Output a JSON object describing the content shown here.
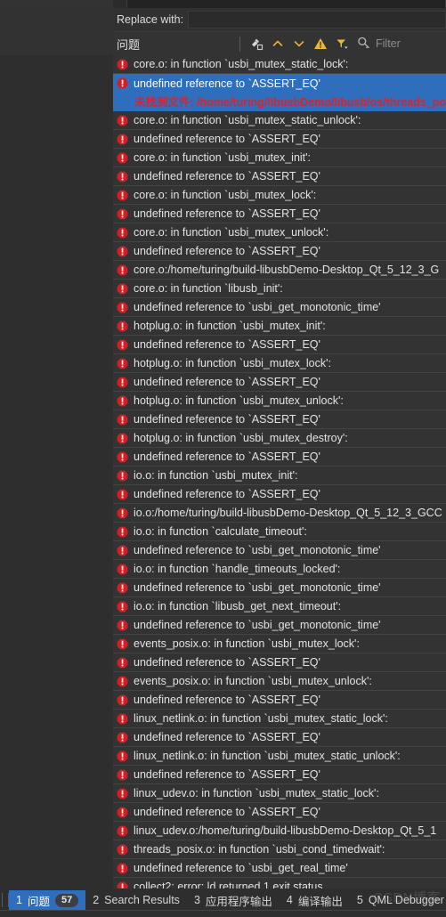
{
  "find_bar": {
    "replace_label": "Replace with:",
    "replace_value": "",
    "replace_placeholder": ""
  },
  "pane": {
    "title": "问题",
    "filter_placeholder": "Filter",
    "toolbar_icons": [
      "clear-issues-icon",
      "previous-issue-icon",
      "next-issue-icon",
      "warning-filter-icon",
      "filter-funnel-icon",
      "search-icon"
    ]
  },
  "colors": {
    "selection_blue": "#2f6ebd",
    "error_red": "#cc2127",
    "pane_bg": "#333333",
    "row_divider": "#434343",
    "warning_yellow": "#e8b931"
  },
  "issues": [
    {
      "text": "core.o: in function `usbi_mutex_static_lock':",
      "selected": false
    },
    {
      "text": "undefined reference to `ASSERT_EQ'",
      "selected": true,
      "detail": "未找到文件: /home/turing/libusbDemo/libusb/os/threads_posix"
    },
    {
      "text": "core.o: in function `usbi_mutex_static_unlock':",
      "selected": false
    },
    {
      "text": "undefined reference to `ASSERT_EQ'",
      "selected": false
    },
    {
      "text": "core.o: in function `usbi_mutex_init':",
      "selected": false
    },
    {
      "text": "undefined reference to `ASSERT_EQ'",
      "selected": false
    },
    {
      "text": "core.o: in function `usbi_mutex_lock':",
      "selected": false
    },
    {
      "text": "undefined reference to `ASSERT_EQ'",
      "selected": false
    },
    {
      "text": "core.o: in function `usbi_mutex_unlock':",
      "selected": false
    },
    {
      "text": "undefined reference to `ASSERT_EQ'",
      "selected": false
    },
    {
      "text": "core.o:/home/turing/build-libusbDemo-Desktop_Qt_5_12_3_G",
      "selected": false
    },
    {
      "text": "core.o: in function `libusb_init':",
      "selected": false
    },
    {
      "text": "undefined reference to `usbi_get_monotonic_time'",
      "selected": false
    },
    {
      "text": "hotplug.o: in function `usbi_mutex_init':",
      "selected": false
    },
    {
      "text": "undefined reference to `ASSERT_EQ'",
      "selected": false
    },
    {
      "text": "hotplug.o: in function `usbi_mutex_lock':",
      "selected": false
    },
    {
      "text": "undefined reference to `ASSERT_EQ'",
      "selected": false
    },
    {
      "text": "hotplug.o: in function `usbi_mutex_unlock':",
      "selected": false
    },
    {
      "text": "undefined reference to `ASSERT_EQ'",
      "selected": false
    },
    {
      "text": "hotplug.o: in function `usbi_mutex_destroy':",
      "selected": false
    },
    {
      "text": "undefined reference to `ASSERT_EQ'",
      "selected": false
    },
    {
      "text": "io.o: in function `usbi_mutex_init':",
      "selected": false
    },
    {
      "text": "undefined reference to `ASSERT_EQ'",
      "selected": false
    },
    {
      "text": "io.o:/home/turing/build-libusbDemo-Desktop_Qt_5_12_3_GCC",
      "selected": false
    },
    {
      "text": "io.o: in function `calculate_timeout':",
      "selected": false
    },
    {
      "text": "undefined reference to `usbi_get_monotonic_time'",
      "selected": false
    },
    {
      "text": "io.o: in function `handle_timeouts_locked':",
      "selected": false
    },
    {
      "text": "undefined reference to `usbi_get_monotonic_time'",
      "selected": false
    },
    {
      "text": "io.o: in function `libusb_get_next_timeout':",
      "selected": false
    },
    {
      "text": "undefined reference to `usbi_get_monotonic_time'",
      "selected": false
    },
    {
      "text": "events_posix.o: in function `usbi_mutex_lock':",
      "selected": false
    },
    {
      "text": "undefined reference to `ASSERT_EQ'",
      "selected": false
    },
    {
      "text": "events_posix.o: in function `usbi_mutex_unlock':",
      "selected": false
    },
    {
      "text": "undefined reference to `ASSERT_EQ'",
      "selected": false
    },
    {
      "text": "linux_netlink.o: in function `usbi_mutex_static_lock':",
      "selected": false
    },
    {
      "text": "undefined reference to `ASSERT_EQ'",
      "selected": false
    },
    {
      "text": "linux_netlink.o: in function `usbi_mutex_static_unlock':",
      "selected": false
    },
    {
      "text": "undefined reference to `ASSERT_EQ'",
      "selected": false
    },
    {
      "text": "linux_udev.o: in function `usbi_mutex_static_lock':",
      "selected": false
    },
    {
      "text": "undefined reference to `ASSERT_EQ'",
      "selected": false
    },
    {
      "text": "linux_udev.o:/home/turing/build-libusbDemo-Desktop_Qt_5_1",
      "selected": false
    },
    {
      "text": "threads_posix.o: in function `usbi_cond_timedwait':",
      "selected": false
    },
    {
      "text": "undefined reference to `usbi_get_real_time'",
      "selected": false
    },
    {
      "text": "collect2: error: ld returned 1 exit status",
      "selected": false
    }
  ],
  "statusbar": {
    "tabs": [
      {
        "num": "1",
        "label": "问题",
        "badge": "57",
        "active": true
      },
      {
        "num": "2",
        "label": "Search Results",
        "badge": "",
        "active": false
      },
      {
        "num": "3",
        "label": "应用程序输出",
        "badge": "",
        "active": false
      },
      {
        "num": "4",
        "label": "编译输出",
        "badge": "",
        "active": false
      },
      {
        "num": "5",
        "label": "QML Debugger Co",
        "badge": "",
        "active": false
      }
    ]
  },
  "watermark": {
    "text": "CSDN博客"
  }
}
